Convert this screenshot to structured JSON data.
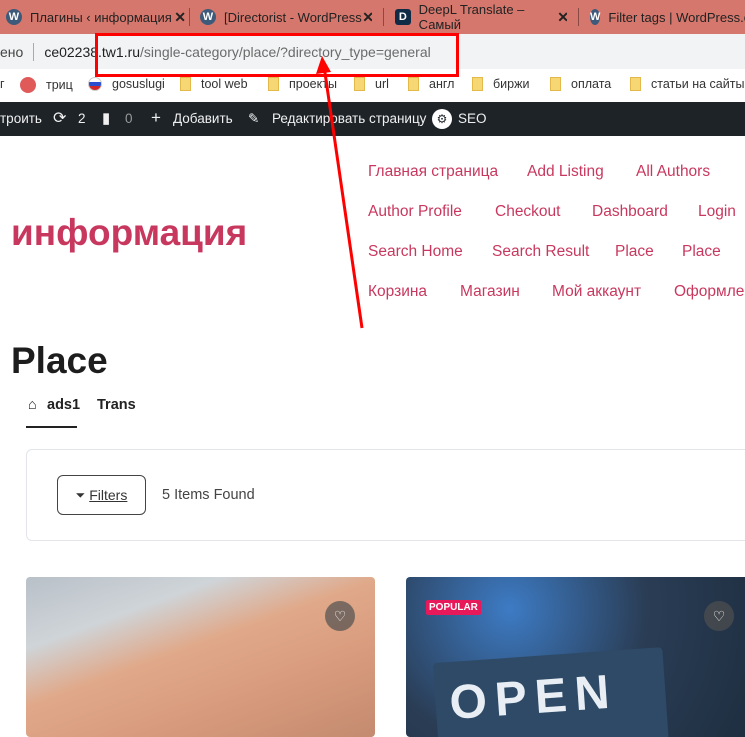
{
  "browser": {
    "tabs": [
      {
        "title": "Плагины ‹ информация"
      },
      {
        "title": "[Directorist - WordPress"
      },
      {
        "title": "DeepL Translate – Самый"
      },
      {
        "title": "Filter tags | WordPress.org"
      }
    ],
    "address": {
      "security": "ено",
      "host": "ce02238.tw1.ru",
      "path": "/single-category/place/?directory_type=general"
    },
    "bookmarks": [
      "г",
      "триц",
      "gosuslugi",
      "tool web",
      "проекты",
      "url",
      "англ",
      "биржи",
      "оплата",
      "статьи на сайты"
    ]
  },
  "admin_bar": {
    "customize": "троить",
    "updates": "2",
    "comments": "0",
    "add": "Добавить",
    "edit": "Редактировать страницу",
    "seo": "SEO"
  },
  "site": {
    "title": "информация",
    "nav": [
      [
        "Главная страница",
        "Add Listing",
        "All Authors"
      ],
      [
        "Author Profile",
        "Checkout",
        "Dashboard",
        "Login"
      ],
      [
        "Search Home",
        "Search Result",
        "Place",
        "Place"
      ],
      [
        "Корзина",
        "Магазин",
        "Мой аккаунт",
        "Оформле"
      ]
    ]
  },
  "page": {
    "title": "Place",
    "directory_tabs": [
      "ads1",
      "Trans"
    ],
    "filters_label": "Filters",
    "items_found": "5 Items Found",
    "cards": [
      {
        "badge": "",
        "icon": "heart-icon"
      },
      {
        "badge": "POPULAR",
        "sign": "OPEN",
        "icon": "heart-icon"
      }
    ]
  },
  "colors": {
    "accent": "#c8385e",
    "annotation": "#ff0000",
    "badge": "#e8195a"
  }
}
